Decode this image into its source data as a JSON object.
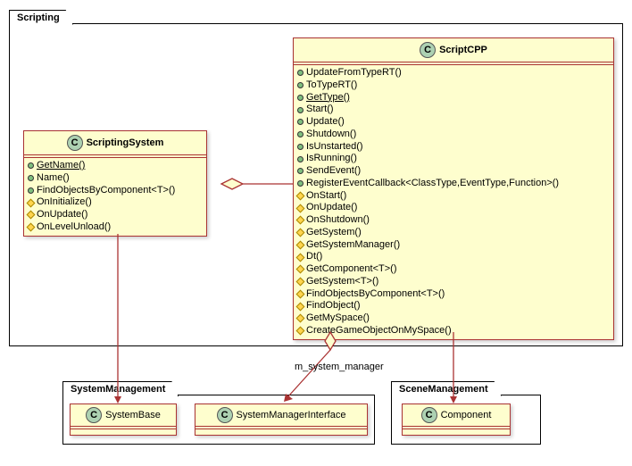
{
  "packages": {
    "scripting": {
      "title": "Scripting"
    },
    "systemManagement": {
      "title": "SystemManagement"
    },
    "sceneManagement": {
      "title": "SceneManagement"
    }
  },
  "classes": {
    "scriptingSystem": {
      "name": "ScriptingSystem",
      "members": [
        {
          "vis": "public",
          "label": "GetName()",
          "abstract": true
        },
        {
          "vis": "public",
          "label": "Name()"
        },
        {
          "vis": "public",
          "label": "FindObjectsByComponent<T>()"
        },
        {
          "vis": "protected",
          "label": "OnInitialize()"
        },
        {
          "vis": "protected",
          "label": "OnUpdate()"
        },
        {
          "vis": "protected",
          "label": "OnLevelUnload()"
        }
      ]
    },
    "scriptCpp": {
      "name": "ScriptCPP",
      "members": [
        {
          "vis": "public",
          "label": "UpdateFromTypeRT()"
        },
        {
          "vis": "public",
          "label": "ToTypeRT()"
        },
        {
          "vis": "public",
          "label": "GetType()",
          "abstract": true
        },
        {
          "vis": "public",
          "label": "Start()"
        },
        {
          "vis": "public",
          "label": "Update()"
        },
        {
          "vis": "public",
          "label": "Shutdown()"
        },
        {
          "vis": "public",
          "label": "IsUnstarted()"
        },
        {
          "vis": "public",
          "label": "IsRunning()"
        },
        {
          "vis": "public",
          "label": "SendEvent()"
        },
        {
          "vis": "public",
          "label": "RegisterEventCallback<ClassType,EventType,Function>()"
        },
        {
          "vis": "protected",
          "label": "OnStart()"
        },
        {
          "vis": "protected",
          "label": "OnUpdate()"
        },
        {
          "vis": "protected",
          "label": "OnShutdown()"
        },
        {
          "vis": "protected",
          "label": "GetSystem()"
        },
        {
          "vis": "protected",
          "label": "GetSystemManager()"
        },
        {
          "vis": "protected",
          "label": "Dt()"
        },
        {
          "vis": "protected",
          "label": "GetComponent<T>()"
        },
        {
          "vis": "protected",
          "label": "GetSystem<T>()"
        },
        {
          "vis": "protected",
          "label": "FindObjectsByComponent<T>()"
        },
        {
          "vis": "protected",
          "label": "FindObject()"
        },
        {
          "vis": "protected",
          "label": "GetMySpace()"
        },
        {
          "vis": "protected",
          "label": "CreateGameObjectOnMySpace()"
        }
      ]
    },
    "systemBase": {
      "name": "SystemBase"
    },
    "systemManagerInterface": {
      "name": "SystemManagerInterface"
    },
    "component": {
      "name": "Component"
    }
  },
  "relations": {
    "m_system_manager": "m_system_manager"
  }
}
